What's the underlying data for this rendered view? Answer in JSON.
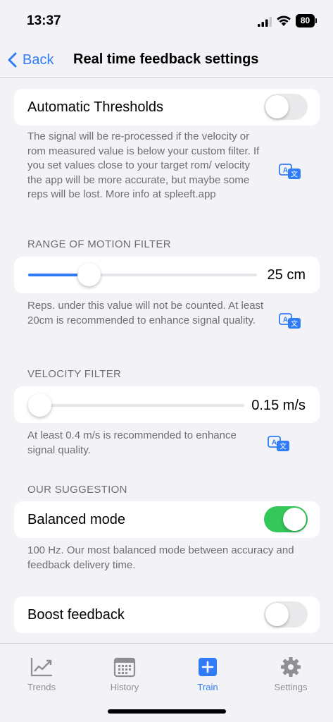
{
  "status_bar": {
    "time": "13:37",
    "battery": "80"
  },
  "nav": {
    "back_label": "Back",
    "title": "Real time feedback settings"
  },
  "automatic_thresholds": {
    "label": "Automatic Thresholds",
    "enabled": false,
    "description": "The signal will be re-processed if the velocity or rom measured value is below your custom filter. If you set values close to your target rom/ velocity the app will be more accurate, but maybe some reps will be lost. More info at spleeft.app"
  },
  "rom_filter": {
    "header": "RANGE OF MOTION FILTER",
    "value_label": "25 cm",
    "fill_fraction": 0.24,
    "description": "Reps. under this value will not be counted. At least 20cm is recommended to enhance signal quality."
  },
  "velocity_filter": {
    "header": "VELOCITY FILTER",
    "value_label": "0.15 m/s",
    "fill_fraction": 0.0,
    "description": "At least 0.4 m/s is recommended to enhance signal quality."
  },
  "suggestion": {
    "header": "OUR SUGGESTION",
    "label": "Balanced mode",
    "enabled": true,
    "description": "100 Hz. Our most balanced mode between accuracy and feedback delivery time."
  },
  "boost": {
    "label": "Boost feedback",
    "enabled": false
  },
  "tabs": [
    {
      "label": "Trends",
      "icon": "trends-icon",
      "active": false
    },
    {
      "label": "History",
      "icon": "calendar-icon",
      "active": false
    },
    {
      "label": "Train",
      "icon": "plus-square-icon",
      "active": true
    },
    {
      "label": "Settings",
      "icon": "gear-icon",
      "active": false
    }
  ],
  "colors": {
    "accent": "#2f7cf6",
    "toggle_on": "#34c759",
    "toggle_off": "#e9e9eb",
    "background": "#f2f2f7",
    "secondary_text": "#6e6e73"
  }
}
